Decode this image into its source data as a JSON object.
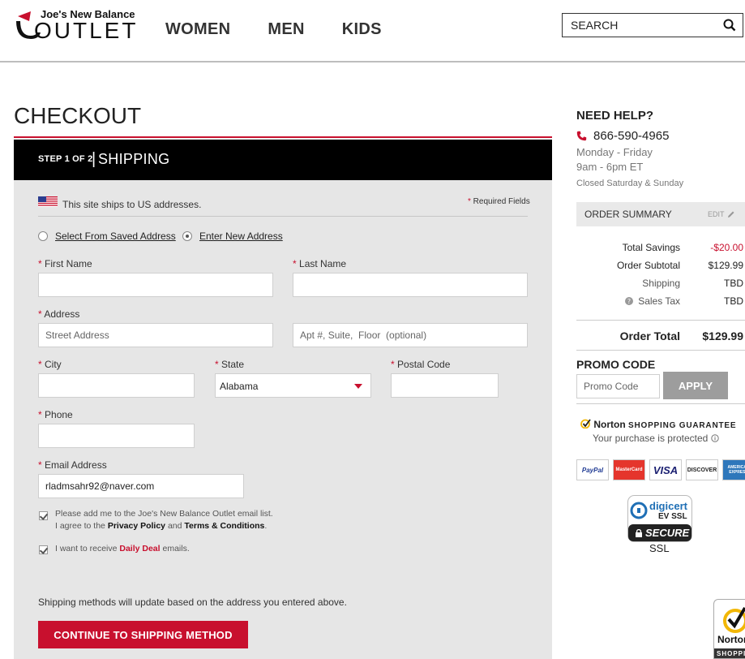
{
  "header": {
    "logo_top": "Joe's New Balance",
    "logo_bottom": "OUTLET",
    "nav": [
      "WOMEN",
      "MEN",
      "KIDS"
    ],
    "search_placeholder": "SEARCH"
  },
  "checkout": {
    "title": "CHECKOUT",
    "step_small": "STEP 1 OF 2",
    "step_sep": "|",
    "step_big": "SHIPPING",
    "ship_note": "This site ships to US addresses.",
    "required_note": "Required Fields",
    "radio_saved": "Select From Saved Address",
    "radio_new": "Enter New Address",
    "labels": {
      "first_name": "First Name",
      "last_name": "Last Name",
      "address": "Address",
      "city": "City",
      "state": "State",
      "postal": "Postal Code",
      "phone": "Phone",
      "email": "Email Address"
    },
    "placeholders": {
      "street": "Street Address",
      "apt": "Apt #, Suite,  Floor  (optional)"
    },
    "state_value": "Alabama",
    "email_value": "rladmsahr92@naver.com",
    "optin1_line1": "Please add me to the Joe's New Balance Outlet email list.",
    "optin1_pre": "I agree to the",
    "privacy": "Privacy Policy",
    "and": "and",
    "terms": "Terms & Conditions",
    "period": ".",
    "optin2_pre": "I want to receive",
    "daily_deal": "Daily Deal",
    "optin2_post": "emails.",
    "ship_methods_note": "Shipping methods will update based on the address you entered above.",
    "continue_label": "CONTINUE TO SHIPPING METHOD"
  },
  "sidebar": {
    "need_help": "NEED HELP?",
    "phone": "866-590-4965",
    "hours1": "Monday - Friday",
    "hours2": "9am - 6pm ET",
    "closed": "Closed Saturday & Sunday",
    "order_summary": "ORDER SUMMARY",
    "edit": "EDIT",
    "rows": [
      {
        "label": "Total Savings",
        "value": "-$20.00"
      },
      {
        "label": "Order Subtotal",
        "value": "$129.99"
      },
      {
        "label": "Shipping",
        "value": "TBD"
      },
      {
        "label": "Sales Tax",
        "value": "TBD"
      }
    ],
    "order_total_label": "Order Total",
    "order_total_value": "$129.99",
    "promo_heading": "PROMO CODE",
    "promo_placeholder": "Promo Code",
    "apply": "APPLY",
    "norton_brand": "Norton",
    "norton_guarantee": "SHOPPING GUARANTEE",
    "protected": "Your purchase is protected",
    "cards": [
      "PayPal",
      "MasterCard",
      "VISA",
      "DISCOVER",
      "AMERICAN EXPRESS"
    ],
    "digicert": "digicert",
    "ev_ssl": "EV SSL",
    "secure": "SECURE",
    "ssl": "SSL",
    "norton_badge_text": "Norton",
    "norton_badge_sub": "SHOPPI"
  },
  "colors": {
    "accent_red": "#c8102e",
    "header_black": "#000000",
    "form_bg": "#e6e6e6",
    "apply_gray": "#9d9d9d"
  }
}
